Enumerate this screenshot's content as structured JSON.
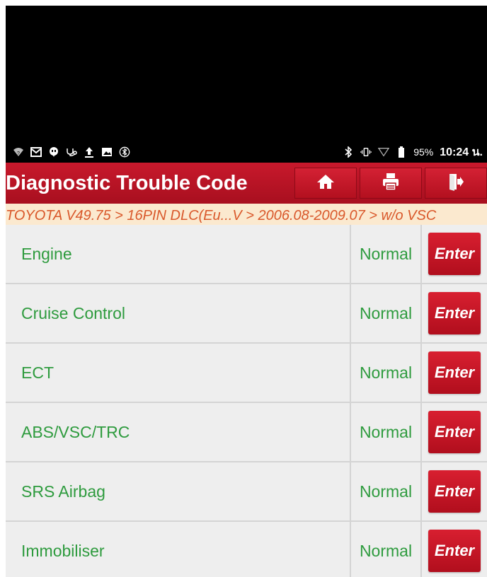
{
  "status_bar": {
    "left_icons": [
      "wifi-question-icon",
      "mail-icon",
      "chat-icon",
      "stethoscope-icon",
      "upload-icon",
      "image-icon",
      "bluetooth-off-icon"
    ],
    "right_icons": [
      "bluetooth-icon",
      "vibrate-icon",
      "signal-icon",
      "battery-icon"
    ],
    "battery": "95%",
    "time": "10:24 น."
  },
  "header": {
    "title": "Diagnostic Trouble Code",
    "buttons": [
      "home-icon",
      "print-icon",
      "exit-icon"
    ],
    "color": "#c8192c"
  },
  "breadcrumb": "TOYOTA V49.75 > 16PIN DLC(Eu...V > 2006.08-2009.07 > w/o VSC",
  "systems": [
    {
      "name": "Engine",
      "status": "Normal",
      "action": "Enter"
    },
    {
      "name": "Cruise Control",
      "status": "Normal",
      "action": "Enter"
    },
    {
      "name": "ECT",
      "status": "Normal",
      "action": "Enter"
    },
    {
      "name": "ABS/VSC/TRC",
      "status": "Normal",
      "action": "Enter"
    },
    {
      "name": "SRS Airbag",
      "status": "Normal",
      "action": "Enter"
    },
    {
      "name": "Immobiliser",
      "status": "Normal",
      "action": "Enter"
    }
  ],
  "colors": {
    "accent_red": "#c8192c",
    "status_green": "#2e9b3e",
    "breadcrumb_text": "#d9582b",
    "breadcrumb_bg": "#fbe9cf"
  }
}
